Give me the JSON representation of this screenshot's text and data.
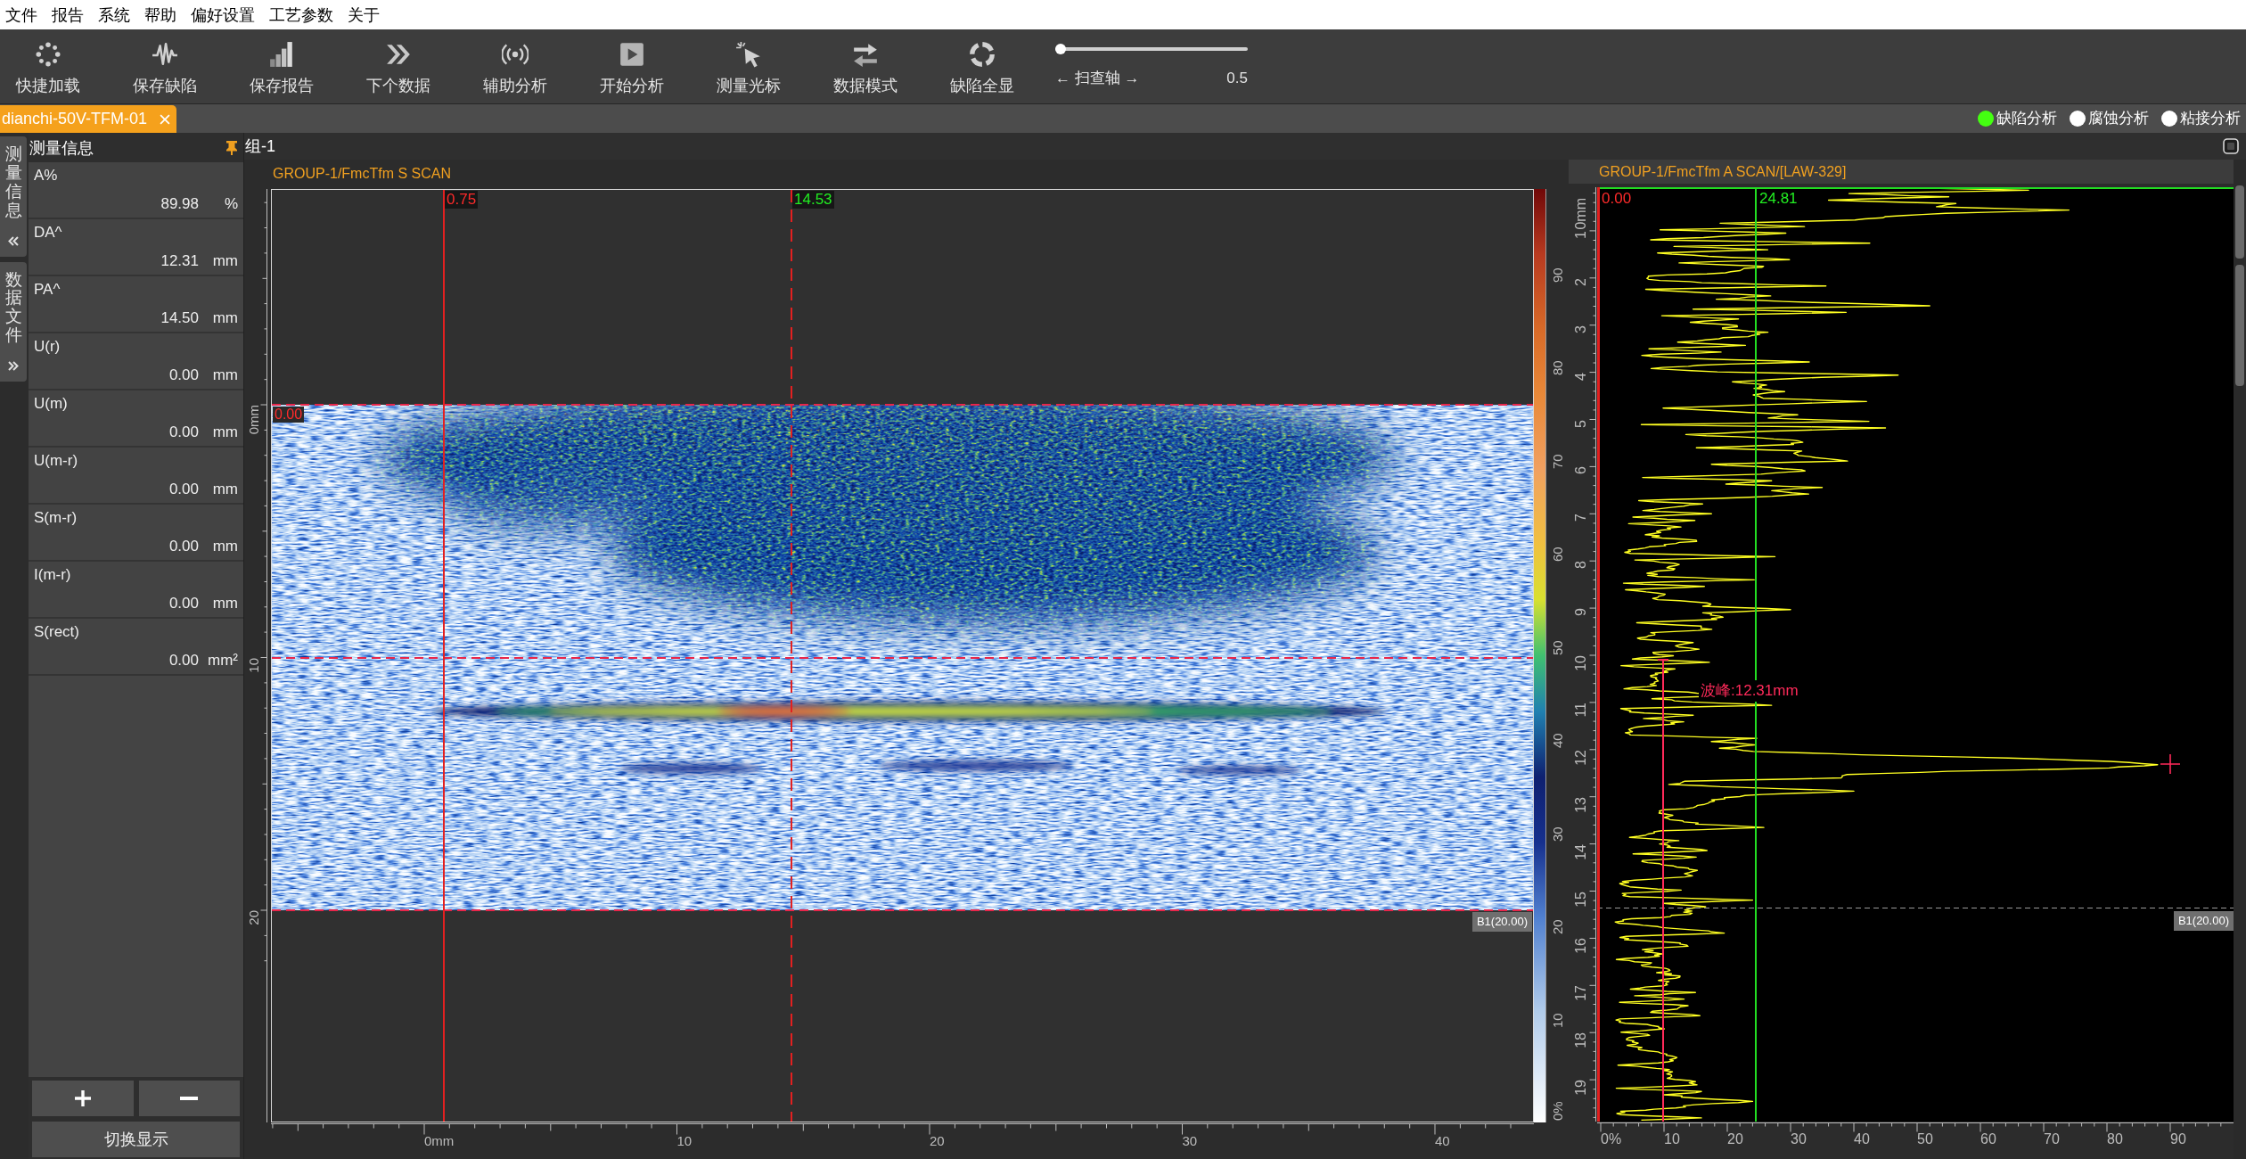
{
  "menu_bar": [
    "文件",
    "报告",
    "系统",
    "帮助",
    "偏好设置",
    "工艺参数",
    "关于"
  ],
  "toolbar": {
    "buttons": [
      "快捷加载",
      "保存缺陷",
      "保存报告",
      "下个数据",
      "辅助分析",
      "开始分析",
      "测量光标",
      "数据模式",
      "缺陷全显"
    ],
    "scan_axis_slider": {
      "label": "← 扫查轴 →",
      "level": 0,
      "value": "0.5"
    }
  },
  "tabs": [
    {
      "label": "dianchi-50V-TFM-01",
      "selected": true
    }
  ],
  "analysis_modes": [
    {
      "label": "缺陷分析",
      "selected": true
    },
    {
      "label": "腐蚀分析",
      "selected": false
    },
    {
      "label": "粘接分析",
      "selected": false
    }
  ],
  "side_tabs": [
    {
      "label": "测量信息",
      "expanded": true
    },
    {
      "label": "数据文件",
      "expanded": false
    }
  ],
  "measurement_panel": {
    "title": "测量信息",
    "rows": [
      {
        "label": "A%",
        "value": "89.98",
        "unit": "%"
      },
      {
        "label": "DA^",
        "value": "12.31",
        "unit": "mm"
      },
      {
        "label": "PA^",
        "value": "14.50",
        "unit": "mm"
      },
      {
        "label": "U(r)",
        "value": "0.00",
        "unit": "mm"
      },
      {
        "label": "U(m)",
        "value": "0.00",
        "unit": "mm"
      },
      {
        "label": "U(m-r)",
        "value": "0.00",
        "unit": "mm"
      },
      {
        "label": "S(m-r)",
        "value": "0.00",
        "unit": "mm"
      },
      {
        "label": "I(m-r)",
        "value": "0.00",
        "unit": "mm"
      },
      {
        "label": "S(rect)",
        "value": "0.00",
        "unit": "mm²"
      }
    ],
    "toggle_button": "切换显示"
  },
  "view_group": {
    "title": "组-1"
  },
  "s_scan": {
    "title": "GROUP-1/FmcTfm S SCAN",
    "cursors": [
      {
        "kind": "reference",
        "label": "0.75"
      },
      {
        "kind": "measure",
        "label": "14.53"
      }
    ],
    "depth_cursor_label": "0.00",
    "gate_label": "B1(20.00)",
    "depth_axis": [
      "0mm",
      "10",
      "20"
    ],
    "scan_axis": [
      "0mm",
      "10",
      "20",
      "30",
      "40"
    ],
    "amplitude_scale": [
      "90",
      "80",
      "70",
      "60",
      "50",
      "40",
      "30",
      "20",
      "10",
      "0%"
    ]
  },
  "a_scan": {
    "title": "GROUP-1/FmcTfm A SCAN/[LAW-329]",
    "cursors": [
      {
        "kind": "reference",
        "label": "0.00"
      },
      {
        "kind": "measure",
        "label": "24.81"
      }
    ],
    "peak_label": "波峰:12.31mm",
    "gate_label": "B1(20.00)",
    "depth_axis": [
      "0mm",
      "1",
      "2",
      "3",
      "4",
      "5",
      "6",
      "7",
      "8",
      "9",
      "10",
      "11",
      "12",
      "13",
      "14",
      "15",
      "16",
      "17",
      "18",
      "19"
    ],
    "amplitude_axis": [
      "0%",
      "10",
      "20",
      "30",
      "40",
      "50",
      "60",
      "70",
      "80",
      "90"
    ]
  }
}
